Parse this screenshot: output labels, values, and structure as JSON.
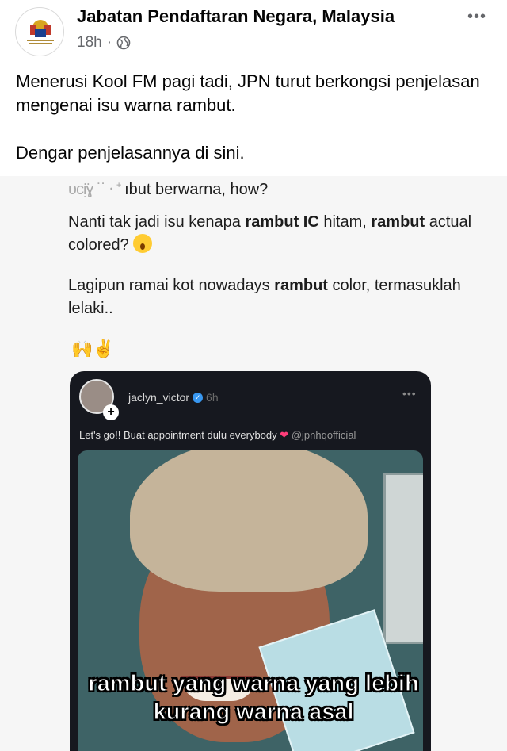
{
  "header": {
    "page_name": "Jabatan Pendaftaran Negara, Malaysia",
    "time": "18h",
    "more_label": "•••"
  },
  "post": {
    "paragraph1": "Menerusi Kool FM pagi tadi, JPN turut berkongsi penjelasan mengenai isu warna rambut.",
    "paragraph2": "Dengar penjelasannya di sini."
  },
  "embed": {
    "cut_line_visible": "ıbut berwarna, how?",
    "line2": "Nanti tak jadi isu kenapa rambut IC hitam, rambut actual colored?",
    "line3": "Lagipun ramai kot nowadays rambut color, termasuklah lelaki..",
    "story": {
      "username": "jaclyn_victor",
      "time": "6h",
      "caption": "Let's go!! Buat appointment dulu everybody",
      "mention": "@jpnhqofficial",
      "more_label": "•••"
    },
    "subtitle_line1": "rambut yang warna yang lebih",
    "subtitle_line2": "kurang warna asal"
  },
  "icons": [
    "more-options-icon",
    "globe-icon",
    "astonished-face-emoji",
    "raising-hands-emoji",
    "victory-hand-emoji",
    "verified-badge-icon",
    "heart-emoji",
    "plus-icon"
  ]
}
